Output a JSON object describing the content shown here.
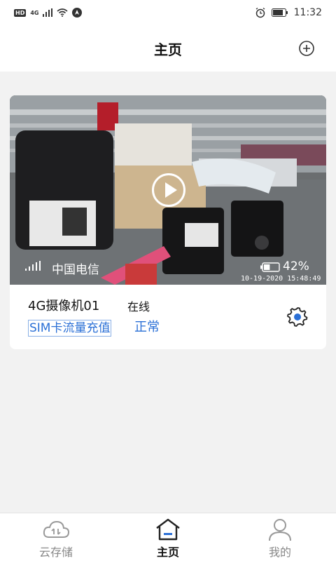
{
  "status_bar": {
    "hd_badge": "HD",
    "network_tag": "4G",
    "time": "11:32"
  },
  "header": {
    "title": "主页",
    "add_icon": "plus-circle-icon"
  },
  "camera_card": {
    "carrier": "中国电信",
    "battery_percent_label": "42%",
    "battery_level": 0.42,
    "timestamp": "10-19-2020 15:48:49",
    "camera_name": "4G摄像机01",
    "online_status": "在线",
    "sim_recharge_label": "SIM卡流量充值",
    "sim_status": "正常",
    "settings_icon": "gear-icon",
    "play_icon": "play-icon"
  },
  "bottom_nav": {
    "items": [
      {
        "label": "云存储",
        "icon": "cloud-icon",
        "active": false
      },
      {
        "label": "主页",
        "icon": "home-icon",
        "active": true
      },
      {
        "label": "我的",
        "icon": "person-icon",
        "active": false
      }
    ]
  },
  "colors": {
    "accent": "#2a6fd6",
    "background": "#f2f2f2"
  }
}
